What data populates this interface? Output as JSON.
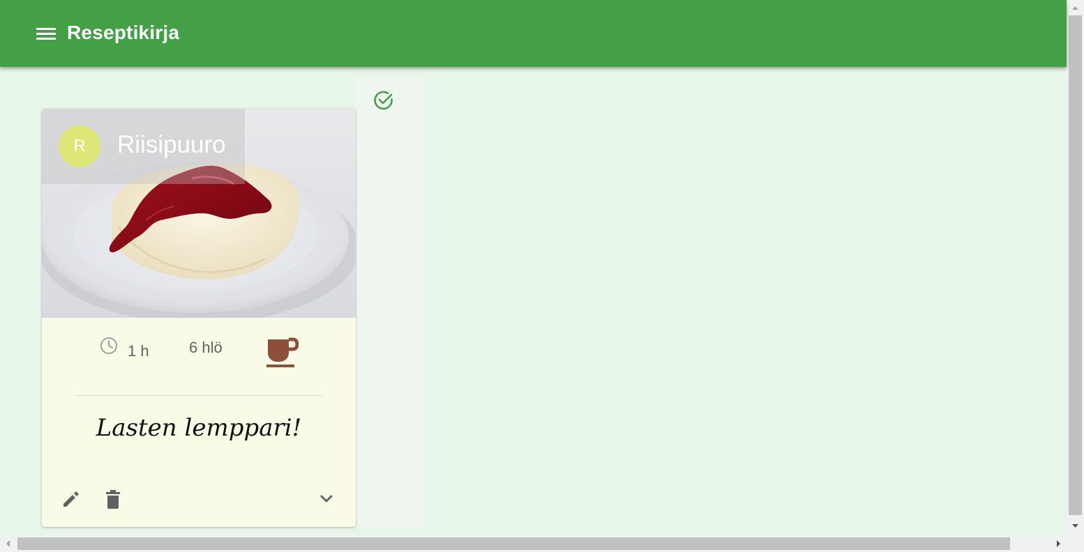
{
  "appbar": {
    "title": "Reseptikirja",
    "color": "#43a047"
  },
  "status_column": {
    "icon": "check-circle-icon",
    "color": "#43a047"
  },
  "recipe_card": {
    "avatar_letter": "R",
    "avatar_color": "#dce775",
    "title": "Riisipuuro",
    "time": "1 h",
    "servings": "6 hlö",
    "category_icon": "coffee-cup-icon",
    "category_color": "#8d4e3a",
    "description": "Lasten lemppari!",
    "actions": {
      "edit_icon": "edit-icon",
      "delete_icon": "delete-icon",
      "expand_icon": "chevron-down-icon"
    }
  }
}
